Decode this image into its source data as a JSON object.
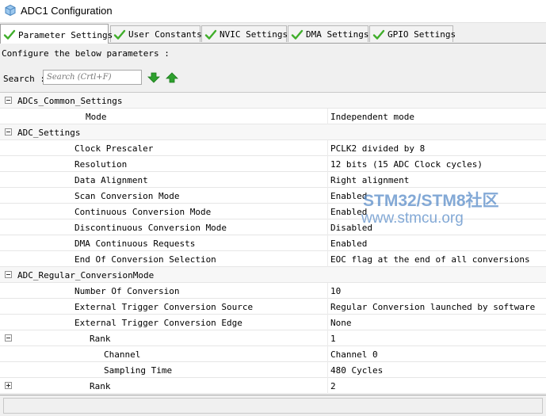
{
  "window": {
    "title": "ADC1 Configuration"
  },
  "tabs": [
    {
      "label": "Parameter Settings",
      "active": true,
      "icon": "check-icon"
    },
    {
      "label": "User Constants",
      "active": false,
      "icon": "check-icon"
    },
    {
      "label": "NVIC Settings",
      "active": false,
      "icon": "check-icon"
    },
    {
      "label": "DMA Settings",
      "active": false,
      "icon": "check-icon"
    },
    {
      "label": "GPIO Settings",
      "active": false,
      "icon": "check-icon"
    }
  ],
  "panel": {
    "instruction": "Configure the below parameters :",
    "search_label": "Search :",
    "search_placeholder": "Search (Crtl+F)",
    "search_value": "",
    "find_next_icon": "arrow-down-icon",
    "find_prev_icon": "arrow-up-icon"
  },
  "params": {
    "groups": [
      {
        "name": "ADCs_Common_Settings",
        "expanded": true,
        "rows": [
          {
            "label": "Mode",
            "value": "Independent mode"
          }
        ]
      },
      {
        "name": "ADC_Settings",
        "expanded": true,
        "rows": [
          {
            "label": "Clock Prescaler",
            "value": "PCLK2 divided by 8"
          },
          {
            "label": "Resolution",
            "value": "12 bits (15 ADC Clock cycles)"
          },
          {
            "label": "Data Alignment",
            "value": "Right alignment"
          },
          {
            "label": "Scan Conversion Mode",
            "value": "Enabled"
          },
          {
            "label": "Continuous Conversion Mode",
            "value": "Enabled"
          },
          {
            "label": "Discontinuous Conversion Mode",
            "value": "Disabled"
          },
          {
            "label": "DMA Continuous Requests",
            "value": "Enabled"
          },
          {
            "label": "End Of Conversion Selection",
            "value": "EOC flag at the end of all conversions"
          }
        ]
      },
      {
        "name": "ADC_Regular_ConversionMode",
        "expanded": true,
        "rows": [
          {
            "label": "Number Of Conversion",
            "value": "10"
          },
          {
            "label": "External Trigger Conversion Source",
            "value": "Regular Conversion launched by software"
          },
          {
            "label": "External Trigger Conversion Edge",
            "value": "None"
          }
        ],
        "ranks": [
          {
            "label": "Rank",
            "value": "1",
            "expanded": true,
            "rows": [
              {
                "label": "Channel",
                "value": "Channel 0"
              },
              {
                "label": "Sampling Time",
                "value": "480 Cycles"
              }
            ]
          },
          {
            "label": "Rank",
            "value": "2",
            "expanded": false,
            "rows": []
          }
        ]
      }
    ]
  },
  "watermark": {
    "line1": "STM32/STM8社区",
    "line2": "www.stmcu.org"
  },
  "colors": {
    "check_green": "#3fae2a",
    "arrow_green": "#2ea02e",
    "watermark": "#5a8cc8"
  }
}
